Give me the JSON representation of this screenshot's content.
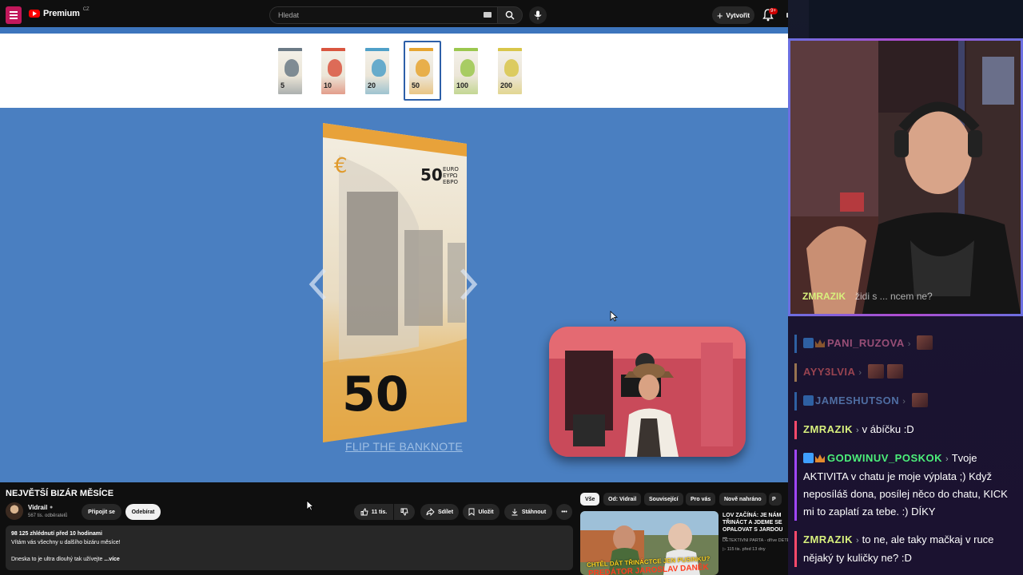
{
  "topbar": {
    "brand": "Premium",
    "region": "CZ",
    "search_placeholder": "Hledat",
    "create_label": "Vytvořit",
    "notif_count": "9+"
  },
  "video": {
    "thumbnails": [
      {
        "value": "5",
        "color": "#6b7a86"
      },
      {
        "value": "10",
        "color": "#d9553f"
      },
      {
        "value": "20",
        "color": "#4fa0c8"
      },
      {
        "value": "50",
        "color": "#e6a531"
      },
      {
        "value": "100",
        "color": "#9bc74e"
      },
      {
        "value": "200",
        "color": "#d8c64a"
      }
    ],
    "selected_index": 3,
    "banknote": {
      "value": "50",
      "currency_lines": [
        "EURO",
        "EYPΩ",
        "EBPO"
      ],
      "accent": "#e8a23a"
    },
    "flip_label": "FLIP THE BANKNOTE"
  },
  "info": {
    "title": "NEJVĚTŠÍ BIZÁR MĚSÍCE",
    "channel_name": "Vidrail",
    "subscribers": "567 tis. odběratelů",
    "join_label": "Připojit se",
    "subscribe_label": "Odebírat",
    "like_count": "11 tis.",
    "share_label": "Sdílet",
    "save_label": "Uložit",
    "download_label": "Stáhnout",
    "desc_stats": "98 125 zhlédnutí  před 10 hodinami",
    "desc_line1": "Vítám vás všechny u dalšího bizáru měsíce!",
    "desc_line2": "Dneska to je ultra dlouhý tak užívejte",
    "desc_more": "...více"
  },
  "recommendations": {
    "chips": [
      "Vše",
      "Od: Vidrail",
      "Související",
      "Pro vás",
      "Nově nahráno"
    ],
    "item": {
      "title": "LOV ZAČÍNÁ: JE NÁM TŘINÁCT A JDEME SE OPALOVAT S JARDOU ...",
      "channel": "DETEKTIVNÍ PARTA - dříve DETEK",
      "meta": "115 tis.   před 13 dny",
      "thumb_caption_top": "CHTĚL DÁT TŘINÁCTCE JEN PUSINKU?",
      "thumb_caption_bottom": "PREDÁTOR JAROSLAV DANĚK"
    }
  },
  "stream": {
    "cam_ghost_name": "ZMRAZIK",
    "cam_ghost_text": "židi s ... ncem ne?",
    "chat": [
      {
        "name": "PANI_RUZOVA",
        "text": "",
        "color": "#ff7fb0",
        "dim": true,
        "emotes": 1
      },
      {
        "name": "AYY3LVIA",
        "text": "",
        "color": "#ff6b6b",
        "dim": true,
        "emotes": 2
      },
      {
        "name": "JAMESHUTSON",
        "text": "",
        "color": "#7ab8ff",
        "dim": true,
        "emotes": 1
      },
      {
        "name": "ZMRAZIK",
        "text": "v ábíčku :D",
        "color": "#d8f07d",
        "dim": false,
        "emotes": 0
      },
      {
        "name": "GODWINUV_POSKOK",
        "text": "Tvoje AKTIVITA v chatu je moje výplata ;) Když neposíláš dona, posílej něco do chatu, KICK mi to zaplatí za tebe. :) DÍKY",
        "color": "#4cf07a",
        "dim": false,
        "emotes": 0
      },
      {
        "name": "ZMRAZIK",
        "text": "to ne, ale taky mačkaj v ruce nějaký ty kuličky ne? :D",
        "color": "#d8f07d",
        "dim": false,
        "emotes": 0
      }
    ]
  }
}
